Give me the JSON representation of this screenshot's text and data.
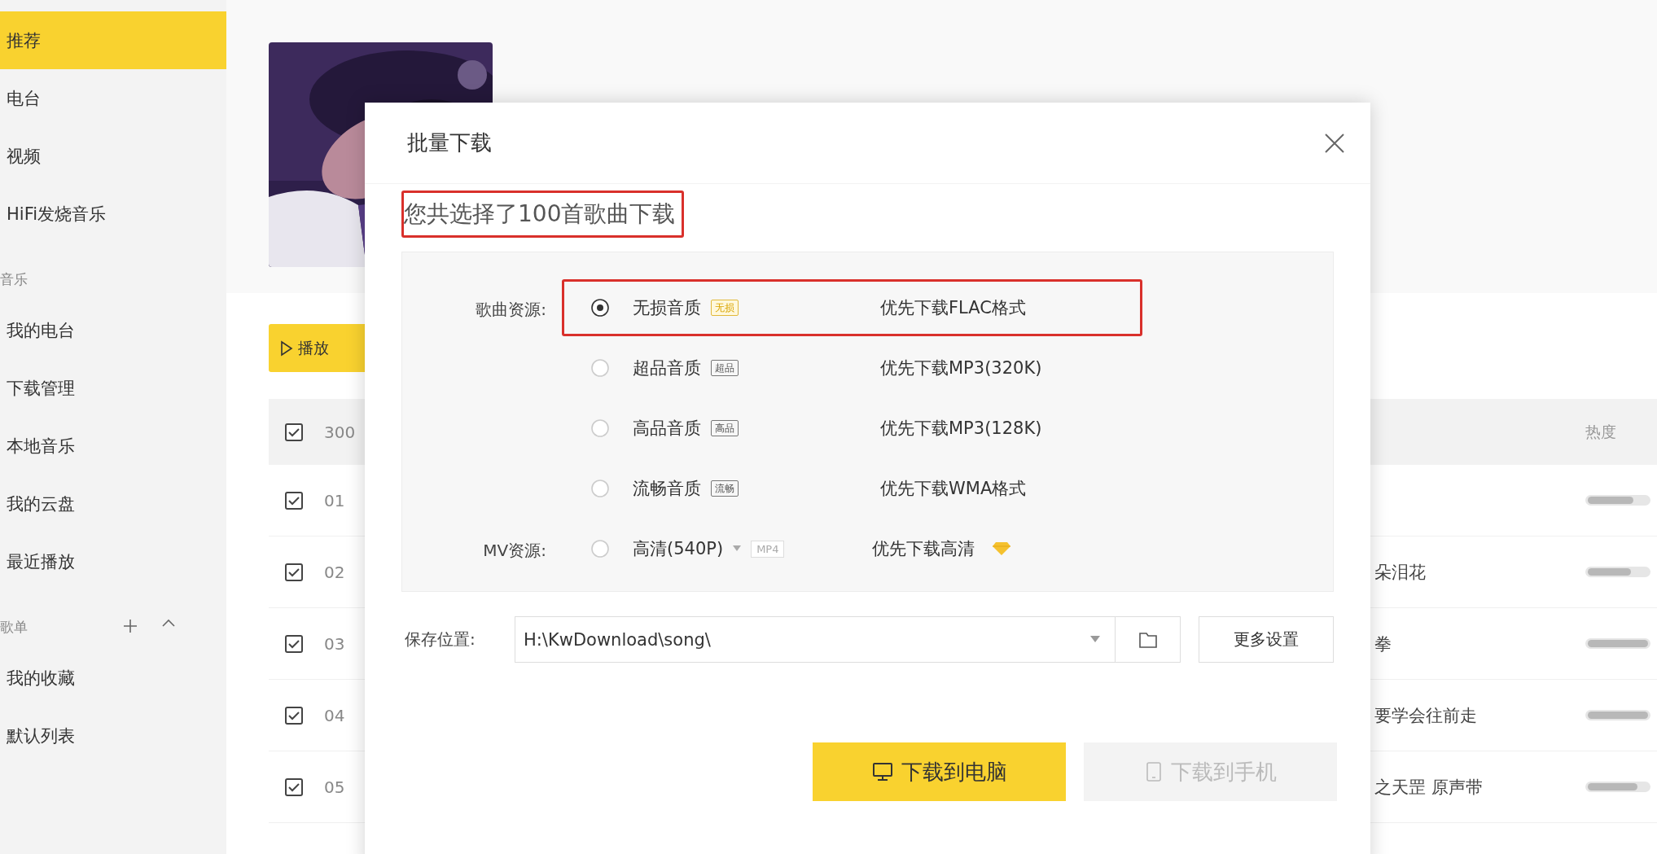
{
  "sidebar": {
    "items": [
      {
        "kind": "item",
        "label": "推荐",
        "selected": true
      },
      {
        "kind": "item",
        "label": "电台",
        "selected": false
      },
      {
        "kind": "item",
        "label": "视频",
        "selected": false
      },
      {
        "kind": "item",
        "label": "HiFi发烧音乐",
        "selected": false
      },
      {
        "kind": "section",
        "label": "音乐"
      },
      {
        "kind": "item",
        "label": "我的电台",
        "selected": false
      },
      {
        "kind": "item",
        "label": "下载管理",
        "selected": false
      },
      {
        "kind": "item",
        "label": "本地音乐",
        "selected": false
      },
      {
        "kind": "item",
        "label": "我的云盘",
        "selected": false
      },
      {
        "kind": "item",
        "label": "最近播放",
        "selected": false
      },
      {
        "kind": "section",
        "label": "歌单",
        "expanded": true
      },
      {
        "kind": "item",
        "label": "我的收藏",
        "selected": false
      },
      {
        "kind": "item",
        "label": "默认列表",
        "selected": false
      }
    ]
  },
  "play_button": {
    "label": "播放"
  },
  "table": {
    "header": {
      "checked": true,
      "count": "300",
      "heat": "热度"
    },
    "rows": [
      {
        "checked": true,
        "index": "01",
        "level": 0.75
      },
      {
        "checked": true,
        "index": "02",
        "title": "朵泪花",
        "level": 0.72
      },
      {
        "checked": true,
        "index": "03",
        "title": "拳",
        "level": 1
      },
      {
        "checked": true,
        "index": "04",
        "title": "要学会往前走",
        "level": 1
      },
      {
        "checked": true,
        "index": "05",
        "title": "之天罡 原声带",
        "level": 0.82
      }
    ]
  },
  "dialog": {
    "title": "批量下载",
    "summary": {
      "text": "您共选择了100首歌曲下载",
      "highlighted": true
    },
    "song_source_label": "歌曲资源:",
    "song_options": [
      {
        "quality": "无损音质",
        "badge": "无损",
        "description": "优先下载FLAC格式",
        "selected": true,
        "highlighted": true
      },
      {
        "quality": "超品音质",
        "badge": "超品",
        "description": "优先下载MP3(320K)",
        "selected": false,
        "highlighted": false
      },
      {
        "quality": "高品音质",
        "badge": "高品",
        "description": "优先下载MP3(128K)",
        "selected": false,
        "highlighted": false
      },
      {
        "quality": "流畅音质",
        "badge": "流畅",
        "description": "优先下载WMA格式",
        "selected": false,
        "highlighted": false
      }
    ],
    "mv_source_label": "MV资源:",
    "mv_option": {
      "quality": "高清(540P)",
      "format": "MP4",
      "description": "优先下载高清",
      "selected": false
    },
    "save_label": "保存位置:",
    "save_path": "H:\\KwDownload\\song\\",
    "more_settings": "更多设置",
    "buttons": [
      {
        "kind": "computer",
        "label": "下载到电脑",
        "disabled": false
      },
      {
        "kind": "phone",
        "label": "下载到手机",
        "disabled": true
      }
    ]
  }
}
